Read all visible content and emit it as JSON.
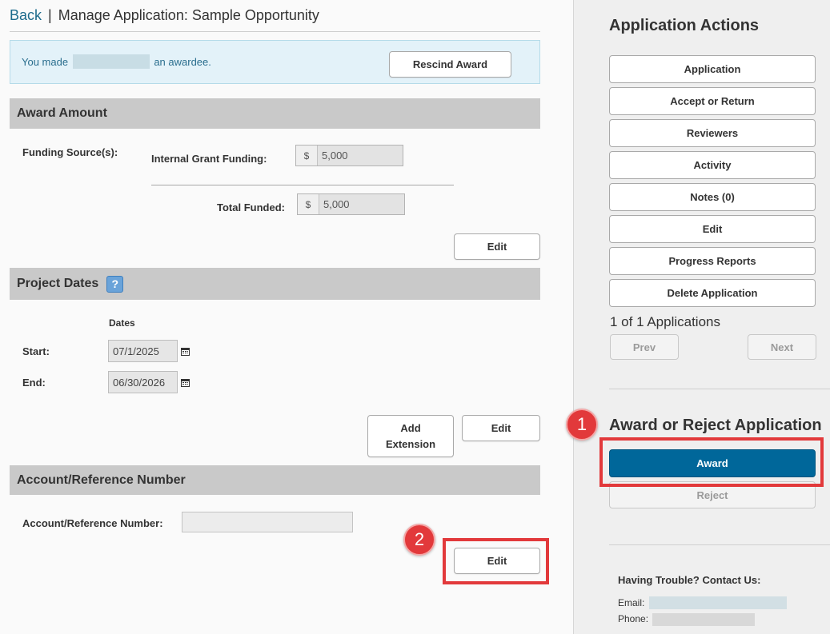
{
  "breadcrumb": {
    "back": "Back",
    "separator": "|",
    "title": "Manage Application: Sample Opportunity"
  },
  "notice": {
    "prefix": "You made",
    "suffix": "an awardee.",
    "rescind_label": "Rescind Award"
  },
  "award_amount": {
    "heading": "Award Amount",
    "funding_sources_label": "Funding Source(s):",
    "internal_label": "Internal Grant Funding:",
    "internal_currency": "$",
    "internal_value": "5,000",
    "total_label": "Total Funded:",
    "total_currency": "$",
    "total_value": "5,000",
    "edit_label": "Edit"
  },
  "project_dates": {
    "heading": "Project Dates",
    "help_symbol": "?",
    "dates_col": "Dates",
    "start_label": "Start:",
    "start_value": "07/1/2025",
    "end_label": "End:",
    "end_value": "06/30/2026",
    "add_extension_line1": "Add",
    "add_extension_line2": "Extension",
    "edit_label": "Edit"
  },
  "account": {
    "heading": "Account/Reference Number",
    "field_label": "Account/Reference Number:",
    "field_value": "",
    "edit_label": "Edit"
  },
  "annotations": {
    "badge1": "1",
    "badge2": "2",
    "highlight_color": "#e2393b"
  },
  "sidebar": {
    "actions_heading": "Application Actions",
    "actions": [
      "Application",
      "Accept or Return",
      "Reviewers",
      "Activity",
      "Notes (0)",
      "Edit",
      "Progress Reports",
      "Delete Application"
    ],
    "count_text": "1 of 1 Applications",
    "prev_label": "Prev",
    "next_label": "Next",
    "award_heading": "Award or Reject Application",
    "award_label": "Award",
    "reject_label": "Reject",
    "contact_heading": "Having Trouble? Contact Us:",
    "email_label": "Email:",
    "phone_label": "Phone:"
  },
  "colors": {
    "award_button": "#00679a",
    "section_header": "#c9c9c9",
    "link": "#1d6b8c"
  }
}
